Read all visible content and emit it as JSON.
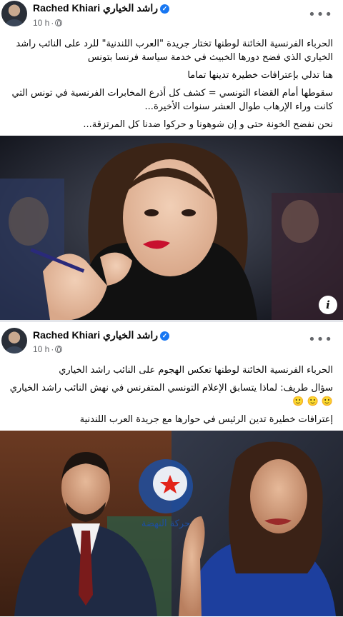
{
  "post1": {
    "author": "Rached Khiari راشد الخياري",
    "time": "10 h",
    "paragraphs": [
      "الحرباء الفرنسية الخائنة لوطنها تختار جريدة \"العرب اللندنية\" للرد على النائب راشد الخياري الذي فضح دورها الخبيث في خدمة سياسة فرنسا بتونس",
      "هنا تدلي بإعترافات خطيرة تدينها تماما",
      "سقوطها أمام القضاء التونسي = كشف كل أذرع المخابرات الفرنسية في تونس التي كانت وراء الإرهاب طوال العشر سنوات الأخيرة...",
      "نحن نفضح الخونة حتى و إن شوهونا و حركوا ضدنا كل المرتزقة..."
    ],
    "photo_icon": "info-icon"
  },
  "post2": {
    "author": "Rached Khiari راشد الخياري",
    "time": "10 h",
    "paragraphs": [
      "الحرباء الفرنسية الخائنة لوطنها تعكس الهجوم على النائب راشد الخياري",
      "سؤال طريف: لماذا يتسابق الإعلام التونسي المتفرنس في نهش النائب راشد الخياري 🙂 🙂 🙂",
      "إعترافات خطيرة تدين الرئيس في حوارها مع جريدة العرب اللندنية"
    ],
    "photo_text": "حركة النهضة"
  },
  "colors": {
    "accent": "#1877f2",
    "secondary_text": "#65676b",
    "text": "#050505"
  }
}
